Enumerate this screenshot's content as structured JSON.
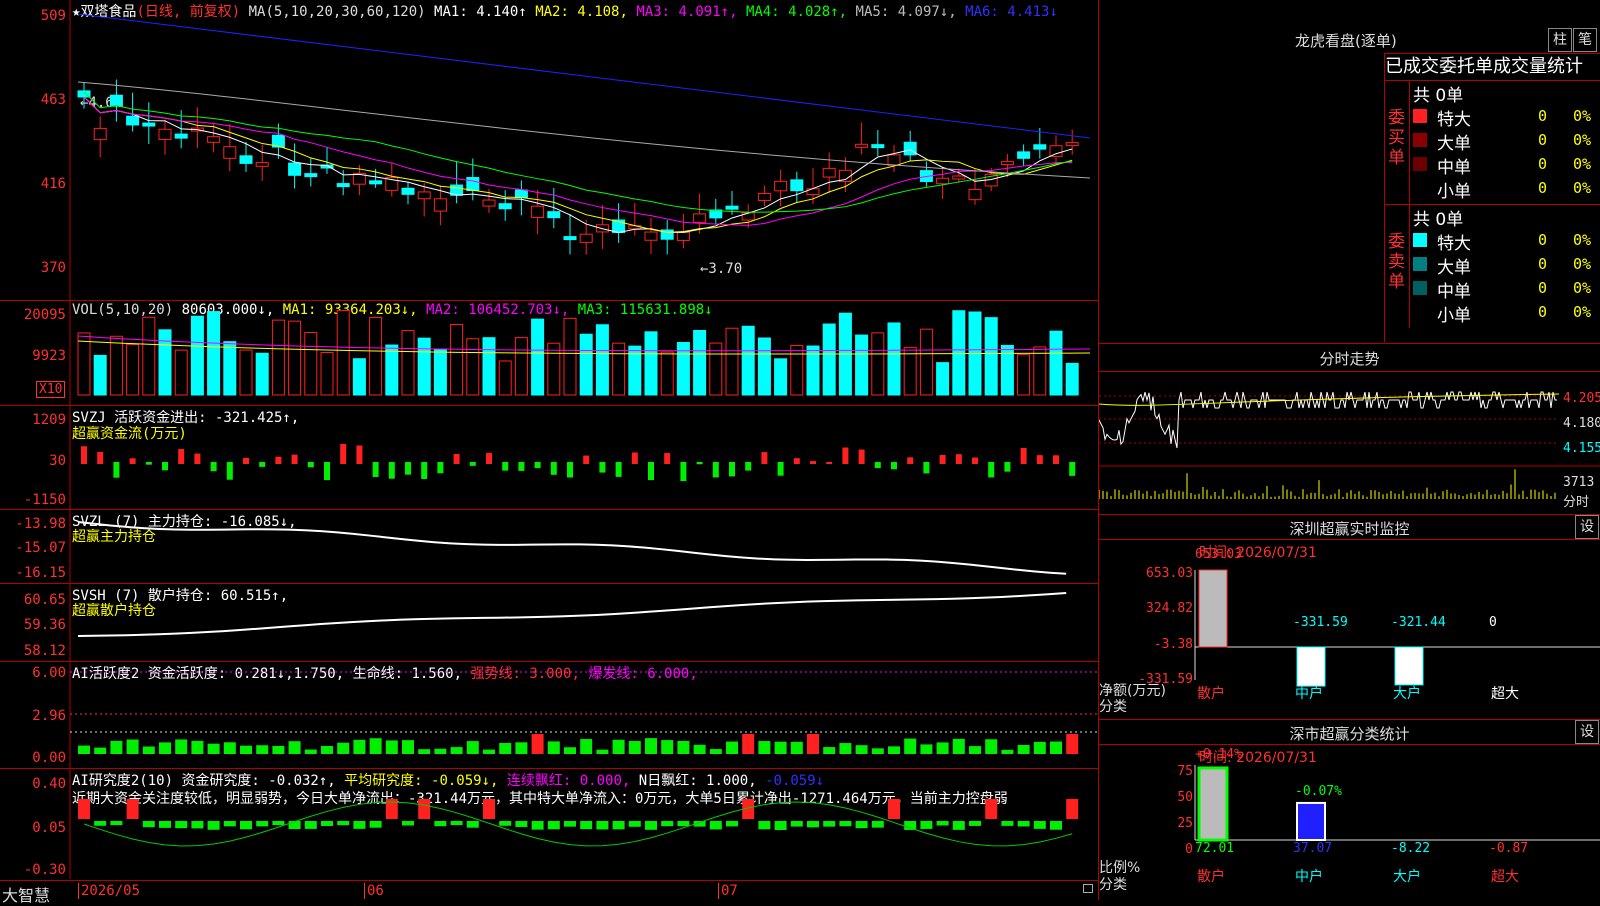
{
  "stock": {
    "name": "双塔食品",
    "mode": "(日线, 前复权)",
    "star": "★"
  },
  "ma": {
    "prefix": "MA(5,10,20,30,60,120)",
    "ma1": "MA1: 4.140↑",
    "ma2": "MA2: 4.108,",
    "ma3": "MA3: 4.091↑,",
    "ma4": "MA4: 4.028↑,",
    "ma5": "MA5: 4.097↓,",
    "ma6": "MA6: 4.413↓"
  },
  "price_axis": [
    "509",
    "463",
    "416",
    "370"
  ],
  "price_marks": {
    "high": "←4.64",
    "low": "←3.70"
  },
  "vol": {
    "title": "VOL(5,10,20)",
    "val": "80603.000↓,",
    "ma1": "MA1: 93364.203↓,",
    "ma2": "MA2: 106452.703↓,",
    "ma3": "MA3: 115631.898↓",
    "axis": [
      "20095",
      "9923"
    ],
    "unit": "X10"
  },
  "svzj": {
    "title": "SVZJ  活跃资金进出: -321.425↑,",
    "sub": "超赢资金流(万元)",
    "axis": [
      "1209",
      "30",
      "-1150"
    ]
  },
  "svzl": {
    "title": "SVZL (7) 主力持仓: -16.085↓,",
    "sub": "超赢主力持仓",
    "axis": [
      "-13.98",
      "-15.07",
      "-16.15"
    ]
  },
  "svsh": {
    "title": "SVSH (7) 散户持仓: 60.515↑,",
    "sub": "超赢散户持仓",
    "axis": [
      "60.65",
      "59.36",
      "58.12"
    ]
  },
  "ai1": {
    "title": "AI活跃度2 资金活跃度: 0.281↓,1.750,",
    "life": "生命线: 1.560,",
    "strong": "强势线: 3.000,",
    "burst": "爆发线: 6.000,",
    "axis": [
      "6.00",
      "2.96",
      "0.00"
    ]
  },
  "ai2": {
    "title": "AI研究度2(10) 资金研究度: -0.032↑,",
    "avg": "平均研究度: -0.059↓,",
    "red": "连续飘红: 0.000,",
    "nred": "N日飘红: 1.000,",
    "last": "-0.059↓",
    "axis": [
      "0.40",
      "0.05",
      "-0.30"
    ],
    "comment": "近期大资金关注度较低，明显弱势，今日大单净流出：-321.44万元，其中特大单净流入：0万元，大单5日累计净出-1271.464万元，当前主力控盘弱"
  },
  "xaxis": {
    "d1": "2026/05",
    "d2": "06",
    "d3": "07"
  },
  "brand": "大智慧",
  "lhb": {
    "title": "龙虎看盘(逐单)",
    "btn1": "柱",
    "btn2": "笔",
    "stat_title": "已成交委托单成交量统计",
    "buy": {
      "side": "委买单",
      "total": "共 0单",
      "rows": [
        {
          "label": "特大",
          "n": "0",
          "p": "0%"
        },
        {
          "label": "大单",
          "n": "0",
          "p": "0%"
        },
        {
          "label": "中单",
          "n": "0",
          "p": "0%"
        },
        {
          "label": "小单",
          "n": "0",
          "p": "0%"
        }
      ]
    },
    "sell": {
      "side": "委卖单",
      "total": "共 0单",
      "rows": [
        {
          "label": "特大",
          "n": "0",
          "p": "0%"
        },
        {
          "label": "大单",
          "n": "0",
          "p": "0%"
        },
        {
          "label": "中单",
          "n": "0",
          "p": "0%"
        },
        {
          "label": "小单",
          "n": "0",
          "p": "0%"
        }
      ]
    }
  },
  "fenshi": {
    "title": "分时走势",
    "axis": [
      "4.205",
      "4.180",
      "4.155"
    ],
    "vol": "3713",
    "volunit": "分时"
  },
  "sz_monitor": {
    "title": "深圳超赢实时监控",
    "btn": "设",
    "time": "时间: 2026/07/31",
    "axis": [
      "653.03",
      "324.82",
      "-3.38",
      "-331.59"
    ],
    "bars": [
      {
        "label": "散户",
        "value": "653.03"
      },
      {
        "label": "中户",
        "value": "-331.59"
      },
      {
        "label": "大户",
        "value": "-321.44"
      },
      {
        "label": "超大",
        "value": "0"
      }
    ],
    "ylabel1": "净额(万元)",
    "ylabel2": "分类"
  },
  "sz_class": {
    "title": "深市超赢分类统计",
    "btn": "设",
    "time": "时间: 2026/07/31",
    "axis": [
      "75",
      "50",
      "25",
      "0"
    ],
    "top": [
      {
        "label": "+0.14%"
      },
      {
        "label": "-0.07%"
      }
    ],
    "bottom": [
      {
        "label": "散户",
        "value": "72.01"
      },
      {
        "label": "中户",
        "value": "37.07"
      },
      {
        "label": "大户",
        "value": "-8.22"
      },
      {
        "label": "超大",
        "value": "-0.87"
      }
    ],
    "ylabel1": "比例%",
    "ylabel2": "分类"
  },
  "colors": {
    "up": "#ff2020",
    "down": "#00ffff",
    "axis": "#ff3030",
    "border": "#b00000",
    "ma1": "#ffffff",
    "ma2": "#ffff00",
    "ma3": "#ff00ff",
    "ma4": "#00ff00",
    "ma5": "#aaaaaa",
    "ma6": "#2020ff"
  }
}
